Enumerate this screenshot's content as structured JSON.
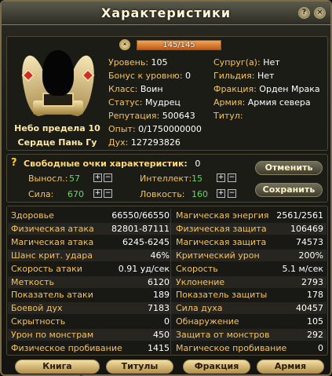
{
  "window": {
    "title": "Характеристики",
    "help_glyph": "?",
    "close_glyph": "×"
  },
  "exp_bar": {
    "text": "145/145",
    "fill_fraction": 1.0
  },
  "emblem": {
    "caption1": "Небо предела 10",
    "caption2": "Сердце Пань Гу"
  },
  "info_left": [
    {
      "label": "Уровень:",
      "value": "105"
    },
    {
      "label": "Бонус к уровню:",
      "value": "0"
    },
    {
      "label": "Класс:",
      "value": "Воин"
    },
    {
      "label": "Статус:",
      "value": "Мудрец"
    },
    {
      "label": "Репутация:",
      "value": "500643"
    },
    {
      "label": "Опыт:",
      "value": "0/1750000000"
    },
    {
      "label": "Дух:",
      "value": "127293826"
    }
  ],
  "info_right": [
    {
      "label": "Супруг(а):",
      "value": "Нет"
    },
    {
      "label": "Гильдия:",
      "value": "Нет"
    },
    {
      "label": "Фракция:",
      "value": "Орден Мрака"
    },
    {
      "label": "Армия:",
      "value": "Армия севера"
    },
    {
      "label": "Титул:",
      "value": ""
    }
  ],
  "free_points": {
    "label": "Свободные очки характеристик:",
    "value": "0",
    "stats": [
      {
        "label": "Выносл.:",
        "value": "57"
      },
      {
        "label": "Интеллект:",
        "value": "15"
      },
      {
        "label": "Сила:",
        "value": "670"
      },
      {
        "label": "Ловкость:",
        "value": "160"
      }
    ],
    "plus": "+",
    "minus": "−",
    "cancel_label": "Отменить",
    "save_label": "Сохранить"
  },
  "stats": [
    {
      "l_label": "Здоровье",
      "l_value": "66550/66550",
      "r_label": "Магическая энергия",
      "r_value": "2561/2561"
    },
    {
      "l_label": "Физическая атака",
      "l_value": "82801-87111",
      "r_label": "Физическая защита",
      "r_value": "106469"
    },
    {
      "l_label": "Магическая атака",
      "l_value": "6245-6245",
      "r_label": "Магическая защита",
      "r_value": "74573"
    },
    {
      "l_label": "Шанс крит. удара",
      "l_value": "46%",
      "r_label": "Критический урон",
      "r_value": "200%"
    },
    {
      "l_label": "Скорость атаки",
      "l_value": "0.91 уд/сек",
      "r_label": "Скорость",
      "r_value": "5.1 м/сек"
    },
    {
      "l_label": "Меткость",
      "l_value": "6120",
      "r_label": "Уклонение",
      "r_value": "2793"
    },
    {
      "l_label": "Показатель атаки",
      "l_value": "189",
      "r_label": "Показатель защиты",
      "r_value": "178"
    },
    {
      "l_label": "Боевой дух",
      "l_value": "7183",
      "r_label": "Сила духа",
      "r_value": "40457"
    },
    {
      "l_label": "Скрытность",
      "l_value": "0",
      "r_label": "Обнаружение",
      "r_value": "105"
    },
    {
      "l_label": "Урон по монстрам",
      "l_value": "450",
      "r_label": "Защита от монстров",
      "r_value": "292"
    },
    {
      "l_label": "Физическое пробивание",
      "l_value": "1415",
      "r_label": "Магическое пробивание",
      "r_value": "0"
    }
  ],
  "bottom_buttons": {
    "generations": "Книга поколений",
    "titles": "Титулы",
    "faction": "Фракция",
    "army": "Армия"
  },
  "colors": {
    "label": "#f7c35e",
    "value": "#ffffff",
    "points_value": "#5fdc5f",
    "frame_border": "#7c6b43"
  }
}
